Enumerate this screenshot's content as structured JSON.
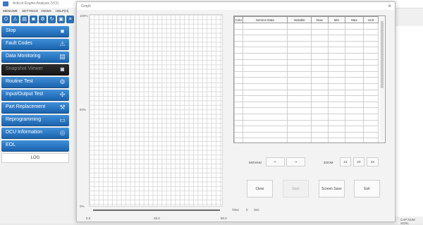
{
  "app": {
    "title": "ActiLot Engine Analysis (VCI)",
    "menu": [
      "MENUWE",
      "SETTINGS",
      "VIEWS",
      "HELP(H)"
    ],
    "toolbar_icons": [
      "power-icon",
      "warning-icon",
      "monitor-icon",
      "camera-icon",
      "gear-icon",
      "refresh-icon",
      "chip-icon",
      "list-icon"
    ]
  },
  "sidebar": {
    "items": [
      {
        "label": "Stop",
        "icon": "stop-icon",
        "glyph": "■",
        "enabled": true
      },
      {
        "label": "Fault Codes",
        "icon": "warning-icon",
        "glyph": "⚠",
        "enabled": true
      },
      {
        "label": "Data Monitoring",
        "icon": "monitor-icon",
        "glyph": "▤",
        "enabled": true
      },
      {
        "label": "Snapshot Viewer",
        "icon": "camera-icon",
        "glyph": "◙",
        "enabled": false
      },
      {
        "label": "Routine Test",
        "icon": "routine-icon",
        "glyph": "⚙",
        "enabled": true
      },
      {
        "label": "Input/Output Test",
        "icon": "io-icon",
        "glyph": "✣",
        "enabled": true
      },
      {
        "label": "Part Replacement",
        "icon": "parts-icon",
        "glyph": "⚒",
        "enabled": true
      },
      {
        "label": "Reprogramming",
        "icon": "reprogram-icon",
        "glyph": "▭",
        "enabled": true
      },
      {
        "label": "DCU Information",
        "icon": "info-icon",
        "glyph": "◎",
        "enabled": true
      },
      {
        "label": "EOL",
        "icon": "eol-icon",
        "glyph": "",
        "enabled": true
      }
    ],
    "log_label": "LOG"
  },
  "status": "CAP NUM SCRL",
  "dialog": {
    "title": "Graph",
    "close": "×",
    "y_axis_labels": [
      "100%",
      "50%",
      "0%"
    ],
    "x_axis_labels": [
      "0.0",
      "25.0",
      "50.0"
    ],
    "time_label": "Time",
    "time_value": "0",
    "time_unit": "Sec",
    "table": {
      "headers": [
        "Colo",
        "Service Data",
        "Variable",
        "Now",
        "Min",
        "Max",
        "Unit"
      ],
      "empty_rows": 22
    },
    "moving": {
      "label": "MOVING",
      "left": "<-",
      "right": "->"
    },
    "zoom": {
      "label": "ZOOM",
      "options": [
        "1X",
        "2X",
        "4X"
      ]
    },
    "buttons": {
      "clear": "Clear",
      "start": "Start",
      "screen_save": "Screen Save",
      "exit": "Exit"
    }
  }
}
